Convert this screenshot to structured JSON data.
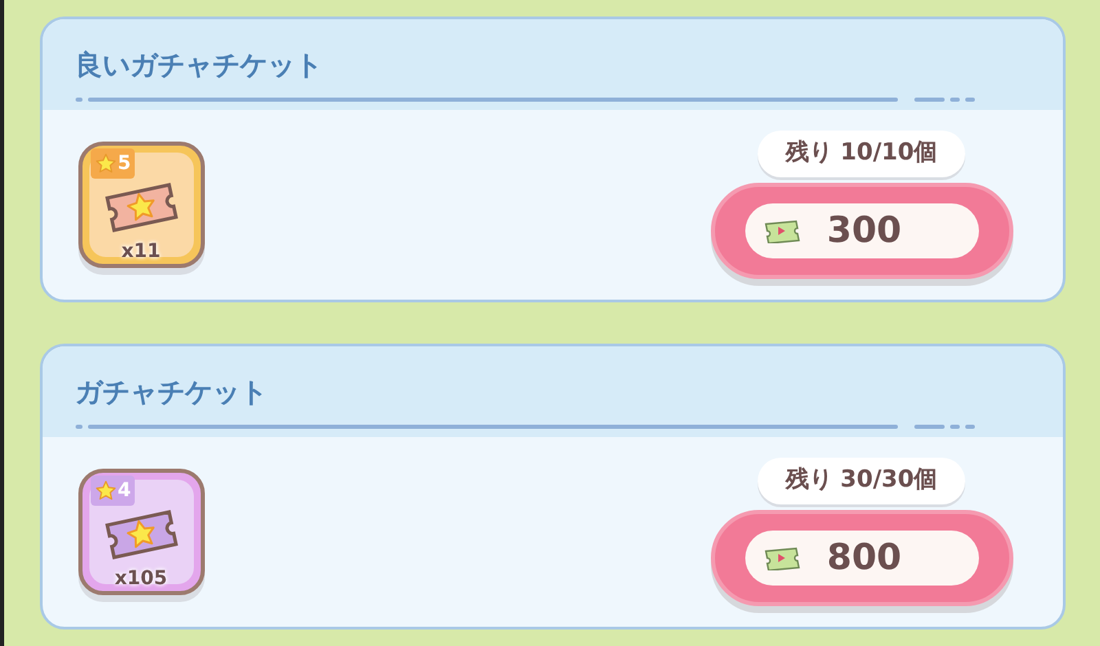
{
  "offers": [
    {
      "title": "良いガチャチケット",
      "item": {
        "kind": "gold",
        "rarity": "5",
        "count": "x11"
      },
      "remaining": "残り 10/10個",
      "price": "300"
    },
    {
      "title": "ガチャチケット",
      "item": {
        "kind": "purple",
        "rarity": "4",
        "count": "x105"
      },
      "remaining": "残り 30/30個",
      "price": "800"
    }
  ]
}
